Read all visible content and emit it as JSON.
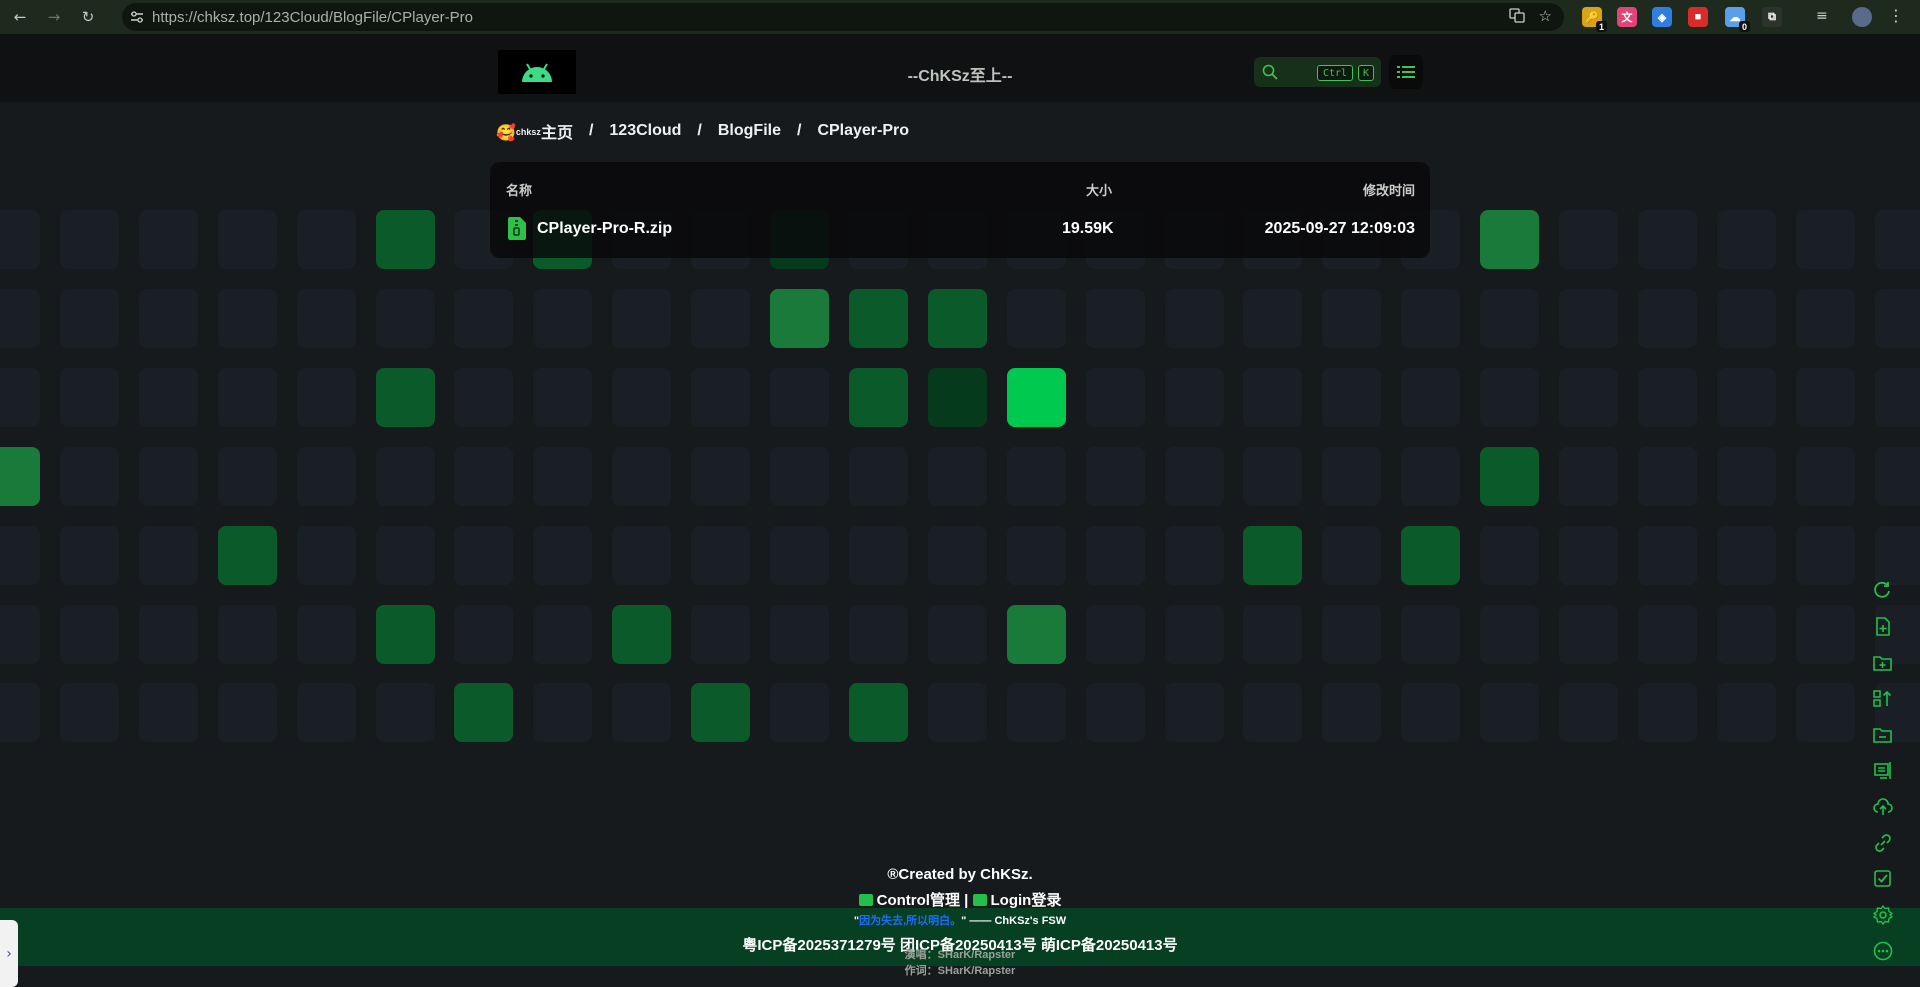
{
  "browser": {
    "url_host": "https://chksz.top",
    "url_path": "/123Cloud/BlogFile/CPlayer-Pro",
    "back_icon": "←",
    "forward_icon": "→",
    "reload_icon": "↻",
    "translate_icon": "translate-icon",
    "bookmark_icon": "☆",
    "extensions": [
      {
        "name": "ext-key",
        "glyph": "🔑",
        "badge": "1",
        "color": "#d8a21a"
      },
      {
        "name": "ext-translate",
        "glyph": "文",
        "badge": "",
        "color": "#e0457a"
      },
      {
        "name": "ext-shield",
        "glyph": "◈",
        "badge": "",
        "color": "#2f7de0"
      },
      {
        "name": "ext-red",
        "glyph": "■",
        "badge": "",
        "color": "#d92b2b"
      },
      {
        "name": "ext-cloud",
        "glyph": "☁",
        "badge": "0",
        "color": "#5aa0e8"
      },
      {
        "name": "ext-puzzle",
        "glyph": "⧉",
        "badge": "",
        "color": "#2b332b"
      }
    ]
  },
  "header": {
    "title": "--ChKSz至上--",
    "search_key1": "Ctrl",
    "search_key2": "K"
  },
  "breadcrumb": {
    "emoji": "🥰",
    "home_sup": "chksz",
    "home": "主页",
    "sep": "/",
    "items": [
      "123Cloud",
      "BlogFile",
      "CPlayer-Pro"
    ]
  },
  "file_table": {
    "col_name": "名称",
    "col_size": "大小",
    "col_modified": "修改时间",
    "rows": [
      {
        "name": "CPlayer-Pro-R.zip",
        "size": "19.59K",
        "modified": "2025-09-27 12:09:03"
      }
    ]
  },
  "footer": {
    "created": "®Created by ChKSz.",
    "control": "Control管理",
    "divider": "|",
    "login": "Login登录",
    "quote_open": "\"",
    "quote_text": "因为失去,所以明白。",
    "quote_close": "\" —— ChKSz's FSW",
    "icp": "粤ICP备2025371279号 团ICP备20250413号 萌ICP备20250413号",
    "credit1": "演唱：SHarK/Rapster",
    "credit2": "作词：SHarK/Rapster"
  },
  "toolbar": {
    "items": [
      "refresh-icon",
      "new-file-icon",
      "new-folder-icon",
      "sort-icon",
      "folder-minus-icon",
      "rename-icon",
      "upload-icon",
      "link-icon",
      "select-icon",
      "settings-icon",
      "more-icon"
    ]
  },
  "colors": {
    "accent": "#22c04a",
    "tile_dark": "#1a1f26",
    "tile_green1": "#00c950",
    "tile_green2": "#1a7a3a",
    "tile_green3": "#0a5a2a",
    "tile_green4": "#063a1d"
  }
}
